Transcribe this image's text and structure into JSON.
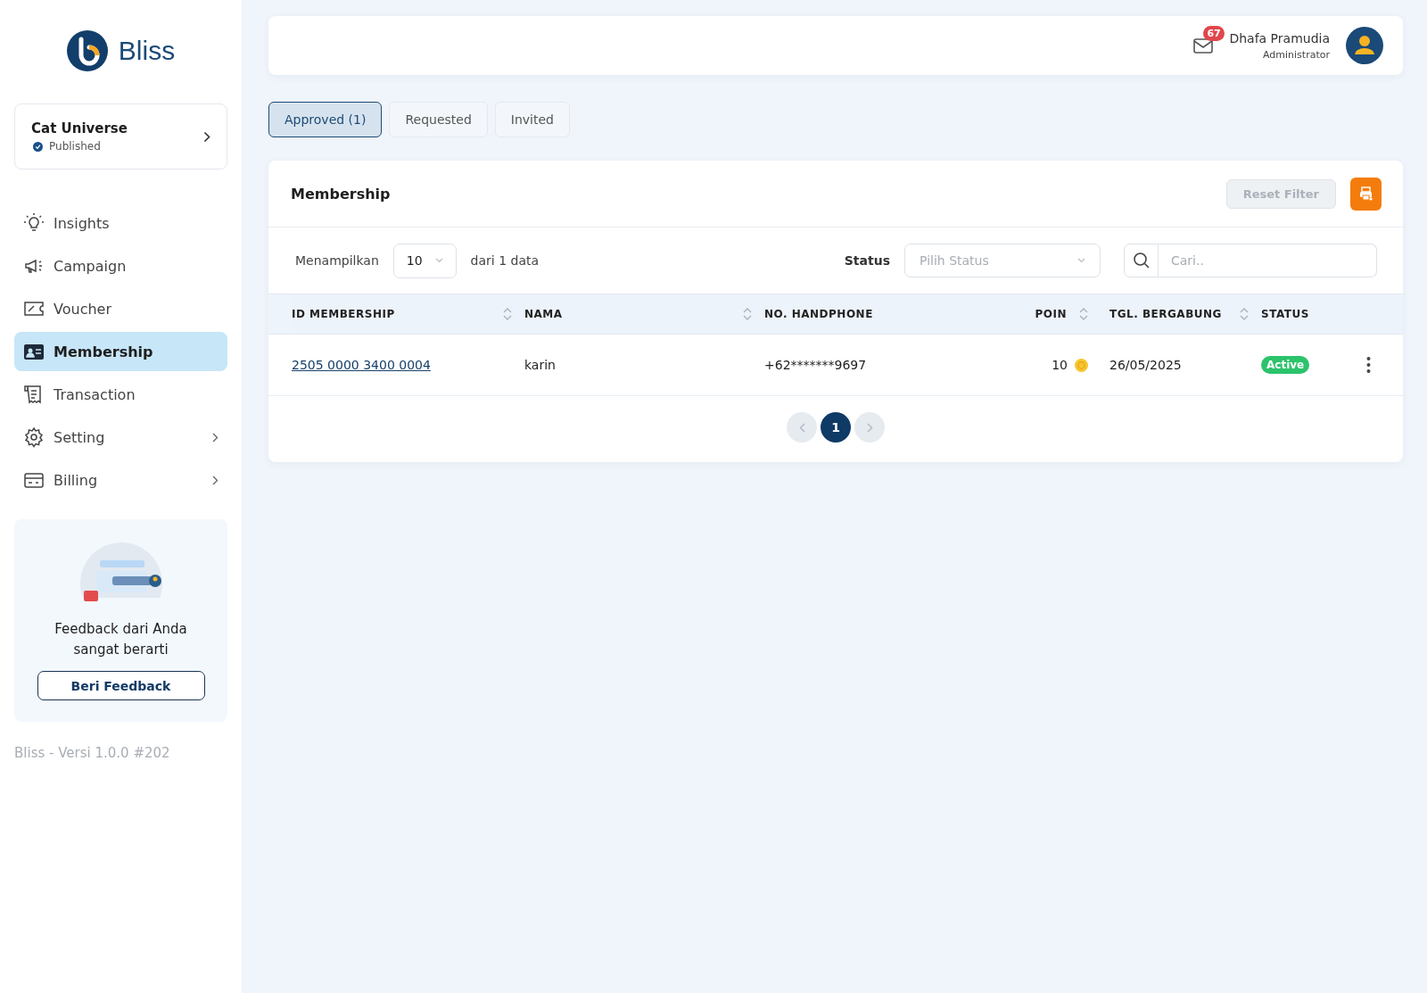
{
  "sidebar": {
    "logo_text": "Bliss",
    "project": {
      "name": "Cat Universe",
      "status": "Published"
    },
    "items": [
      {
        "label": "Insights",
        "selected": false,
        "has_submenu": false
      },
      {
        "label": "Campaign",
        "selected": false,
        "has_submenu": false
      },
      {
        "label": "Voucher",
        "selected": false,
        "has_submenu": false
      },
      {
        "label": "Membership",
        "selected": true,
        "has_submenu": false
      },
      {
        "label": "Transaction",
        "selected": false,
        "has_submenu": false
      },
      {
        "label": "Setting",
        "selected": false,
        "has_submenu": true
      },
      {
        "label": "Billing",
        "selected": false,
        "has_submenu": true
      }
    ],
    "feedback": {
      "text": "Feedback dari Anda sangat berarti",
      "button": "Beri Feedback"
    },
    "version": "Bliss - Versi 1.0.0 #202"
  },
  "header": {
    "notification_count": "67",
    "user_name": "Dhafa Pramudia",
    "user_role": "Administrator"
  },
  "tabs": [
    {
      "label": "Approved (1)",
      "selected": true
    },
    {
      "label": "Requested",
      "selected": false
    },
    {
      "label": "Invited",
      "selected": false
    }
  ],
  "card": {
    "title": "Membership",
    "reset_button": {
      "label": "Reset Filter",
      "disabled": true
    },
    "show_label": "Menampilkan",
    "page_size": "10",
    "total_text": "dari 1 data",
    "status_label": "Status",
    "status_placeholder": "Pilih Status",
    "search_placeholder": "Cari..",
    "columns": [
      {
        "label": "ID MEMBERSHIP",
        "sortable": true
      },
      {
        "label": "NAMA",
        "sortable": true
      },
      {
        "label": "NO. HANDPHONE",
        "sortable": false
      },
      {
        "label": "POIN",
        "sortable": true
      },
      {
        "label": "TGL. BERGABUNG",
        "sortable": true
      },
      {
        "label": "STATUS",
        "sortable": false
      }
    ],
    "rows": [
      {
        "id": "2505 0000 3400 0004",
        "name": "karin",
        "phone": "+62*******9697",
        "points": "10",
        "joined": "26/05/2025",
        "status": "Active",
        "active": true
      }
    ],
    "pages": [
      {
        "label": "1",
        "selected": true
      }
    ]
  }
}
